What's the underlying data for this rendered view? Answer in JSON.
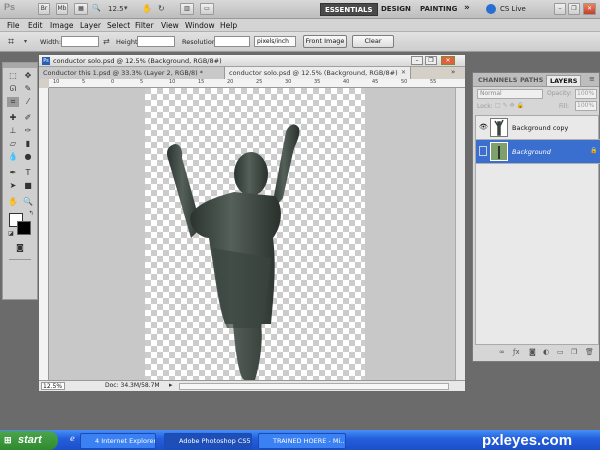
{
  "app": {
    "logo": "Ps",
    "zoom_value": "12.5",
    "workspaces": [
      "ESSENTIALS",
      "DESIGN",
      "PAINTING"
    ],
    "more": "»",
    "cslive": "CS Live"
  },
  "menu": [
    "File",
    "Edit",
    "Image",
    "Layer",
    "Select",
    "Filter",
    "View",
    "Window",
    "Help"
  ],
  "options": {
    "width_label": "Width:",
    "height_label": "Height:",
    "resolution_label": "Resolution:",
    "units": "pixels/inch",
    "front_image": "Front Image",
    "clear": "Clear"
  },
  "document": {
    "window_title": "conductor solo.psd @ 12.5% (Background, RGB/8#)",
    "tabs": [
      "Conductor this 1.psd @ 33.3% (Layer 2, RGB/8) *",
      "conductor solo.psd @ 12.5% (Background, RGB/8#)"
    ],
    "ruler_labels": [
      "10",
      "5",
      "0",
      "5",
      "10",
      "15",
      "20",
      "25",
      "30",
      "35",
      "40",
      "45",
      "50",
      "55"
    ],
    "zoom": "12.5%",
    "doc_info": "Doc: 34.3M/58.7M"
  },
  "layers_panel": {
    "tabs": [
      "CHANNELS",
      "PATHS",
      "LAYERS"
    ],
    "blend_mode": "Normal",
    "opacity_label": "Opacity:",
    "opacity": "100%",
    "lock_label": "Lock:",
    "fill_label": "Fill:",
    "fill": "100%",
    "layers": [
      {
        "name": "Background copy",
        "selected": false
      },
      {
        "name": "Background",
        "selected": true
      }
    ]
  },
  "taskbar": {
    "start": "start",
    "buttons": [
      "4 Internet Explorer",
      "Adobe Photoshop CS5",
      "TRAINED HOERE - Mi..."
    ],
    "watermark": "pxleyes.com"
  },
  "colors": {
    "selection_blue": "#3a6fd0",
    "taskbar_blue": "#245edc",
    "start_green": "#2f8a2f"
  }
}
